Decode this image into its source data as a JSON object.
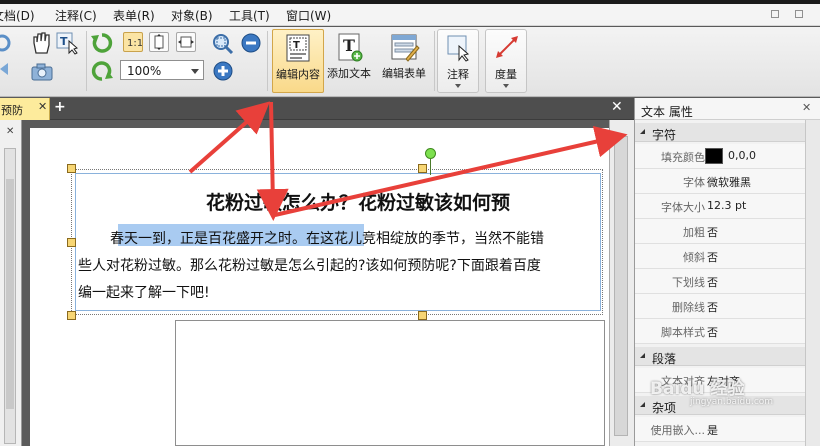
{
  "menu": [
    "文档(D)",
    "注释(C)",
    "表单(R)",
    "对象(B)",
    "工具(T)",
    "窗口(W)"
  ],
  "toolbar": {
    "zoom_value": "100%",
    "edit_content_label": "编辑内容",
    "add_text_label": "添加文本",
    "edit_form_label": "编辑表单",
    "annotate_label": "注释",
    "measure_label": "度量"
  },
  "tabs": {
    "active_doc": "预防",
    "close_glyph": "✕",
    "add_glyph": "+"
  },
  "document": {
    "title": "花粉过敏怎么办？花粉过敏该如何预",
    "line1": "春天一到，正是百花盛开之时。在这花儿竞相绽放的季节，当然不能错",
    "line2": "些人对花粉过敏。那么花粉过敏是怎么引起的?该如何预防呢?下面跟着百度",
    "line3": "编一起来了解一下吧!"
  },
  "properties": {
    "panel_title": "文本 属性",
    "section_char": "字符",
    "fill_color_label": "填充颜色",
    "fill_color_value": "0,0,0",
    "font_label": "字体",
    "font_value": "微软雅黑",
    "font_size_label": "字体大小",
    "font_size_value": "12.3 pt",
    "bold_label": "加粗",
    "bold_value": "否",
    "italic_label": "倾斜",
    "italic_value": "否",
    "underline_label": "下划线",
    "underline_value": "否",
    "strike_label": "删除线",
    "strike_value": "否",
    "script_label": "脚本样式",
    "script_value": "否",
    "section_para": "段落",
    "align_label": "文本对齐",
    "align_value": "左对齐",
    "section_misc": "杂项",
    "embed_label": "使用嵌入...",
    "embed_value": "是"
  },
  "watermark": {
    "main": "Baidu 经验",
    "sub": "jingyan.baidu.com"
  },
  "colors": {
    "accent_arrow": "#e8403a",
    "active_button": "#f9d98a",
    "selection_highlight": "#a9cbf1"
  }
}
